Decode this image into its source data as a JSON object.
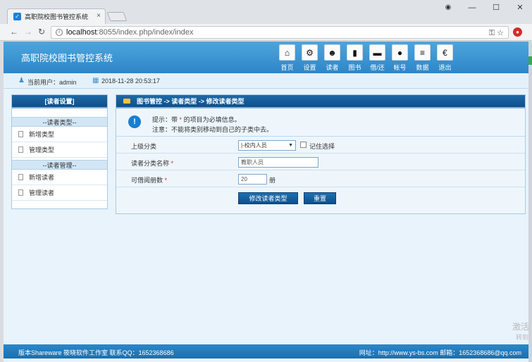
{
  "browser": {
    "tab_title": "高职院校图书管控系统",
    "tab_close": "×",
    "url_host": "localhost",
    "url_path": ":8055/index.php/index/index",
    "window_buttons": [
      "—",
      "☐",
      "✕"
    ]
  },
  "app": {
    "title": "高职院校图书管控系统",
    "nav": [
      {
        "label": "首页",
        "icon": "home-icon",
        "glyph": "⌂"
      },
      {
        "label": "设置",
        "icon": "settings-icon",
        "glyph": "⚙"
      },
      {
        "label": "读者",
        "icon": "readers-icon",
        "glyph": "☻"
      },
      {
        "label": "图书",
        "icon": "books-icon",
        "glyph": "▮"
      },
      {
        "label": "借/还",
        "icon": "borrow-return-icon",
        "glyph": "▬"
      },
      {
        "label": "帐号",
        "icon": "account-icon",
        "glyph": "●"
      },
      {
        "label": "数据",
        "icon": "database-icon",
        "glyph": "≡"
      },
      {
        "label": "退出",
        "icon": "logout-icon",
        "glyph": "€"
      }
    ],
    "current_user_label": "当前用户：admin",
    "datetime": "2018-11-28 20:53:17"
  },
  "sidebar": {
    "header": "[读者设置]",
    "section1": "--读者类型--",
    "items1": [
      "新增类型",
      "管理类型"
    ],
    "section2": "--读者管理--",
    "items2": [
      "新增读者",
      "管理读者"
    ]
  },
  "breadcrumb": "图书管控 -> 读者类型 -> 修改读者类型",
  "notice": {
    "prefix": "提示：带",
    "star": "*",
    "suffix": "的项目为必填信息。",
    "line2": "注意：不能将类别移动到自己的子类中去。"
  },
  "form": {
    "parent_label": "上级分类",
    "parent_value": "|-校内人员",
    "remember_label": "记住选择",
    "name_label": "读者分类名称",
    "name_value": "教职人员",
    "quota_label": "可借阅册数",
    "quota_value": "20",
    "quota_unit": "册",
    "required_mark": "*",
    "submit": "修改读者类型",
    "reset": "重置"
  },
  "footer": {
    "left": "版本Shareware   筱晓软件工作室   联系QQ：1652368686",
    "right": "网址：http://www.ys-bs.com   邮箱：1652368686@qq.com"
  },
  "watermark": "激活",
  "watermark2": "转到"
}
